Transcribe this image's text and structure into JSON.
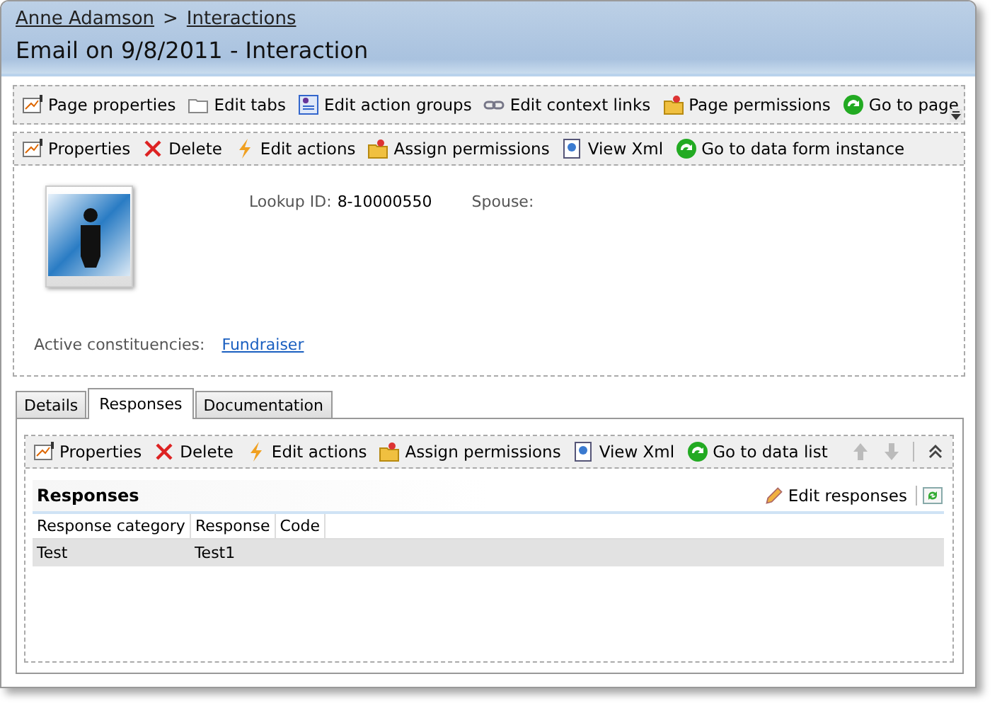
{
  "breadcrumb": [
    {
      "label": "Anne Adamson"
    },
    {
      "label": "Interactions"
    }
  ],
  "breadcrumb_separator": ">",
  "title": "Email on 9/8/2011 - Interaction",
  "page_toolbar": [
    "Page properties",
    "Edit tabs",
    "Edit action groups",
    "Edit context links",
    "Page permissions",
    "Go to page"
  ],
  "form_toolbar": [
    "Properties",
    "Delete",
    "Edit actions",
    "Assign permissions",
    "View Xml",
    "Go to data form instance"
  ],
  "summary": {
    "fields": [
      {
        "label": "Lookup ID:",
        "value": "8-10000550"
      },
      {
        "label": "Spouse:"
      }
    ],
    "constituencies_label": "Active constituencies:",
    "constituencies": [
      "Fundraiser"
    ]
  },
  "tabs": [
    {
      "label": "Details",
      "selected": false
    },
    {
      "label": "Responses",
      "selected": true
    },
    {
      "label": "Documentation",
      "selected": false
    }
  ],
  "tab_toolbar": [
    "Properties",
    "Delete",
    "Edit actions",
    "Assign permissions",
    "View Xml",
    "Go to data list"
  ],
  "list": {
    "title": "Responses",
    "action": "Edit responses",
    "columns": [
      "Response category",
      "Response",
      "Code"
    ],
    "rows": [
      {
        "cells": [
          "Test",
          "Test1",
          ""
        ],
        "selected": true
      }
    ]
  }
}
